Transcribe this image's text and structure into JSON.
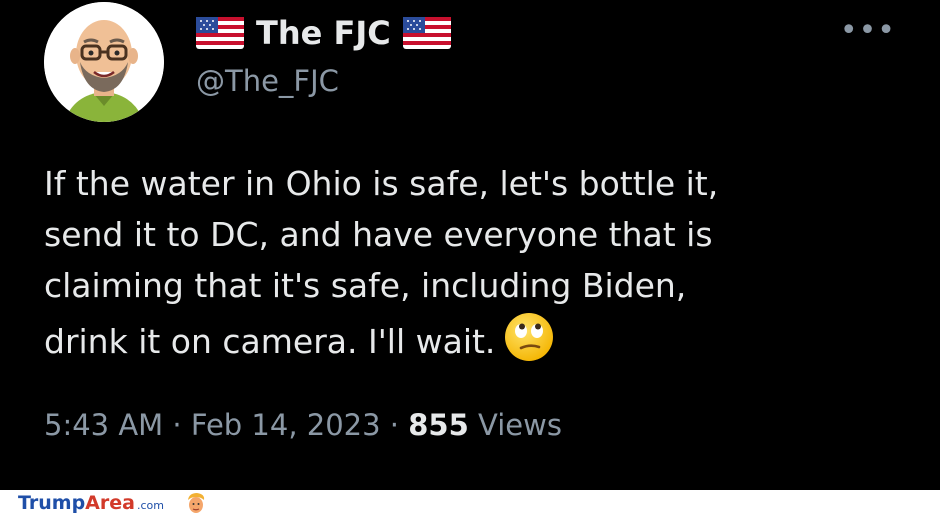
{
  "tweet": {
    "display_name": "The FJC",
    "handle": "@The_FJC",
    "more_label": "•••",
    "text_lines": [
      "If the water in Ohio is safe, let's bottle it,",
      "send it to DC, and have everyone that is",
      "claiming that it's safe, including Biden,",
      "drink it on camera.  I'll wait."
    ],
    "emoji": "face-with-rolling-eyes",
    "time": "5:43 AM",
    "date": "Feb 14, 2023",
    "views_count": "855",
    "views_label": "Views",
    "separator": "·"
  },
  "watermark": {
    "part1": "Trump",
    "part2": "Area",
    "part3": ".com"
  },
  "colors": {
    "background": "#000000",
    "text": "#e7e9ea",
    "secondary_text": "#8b98a5",
    "brand_blue": "#1f4fa8",
    "brand_red": "#d23a2a"
  }
}
